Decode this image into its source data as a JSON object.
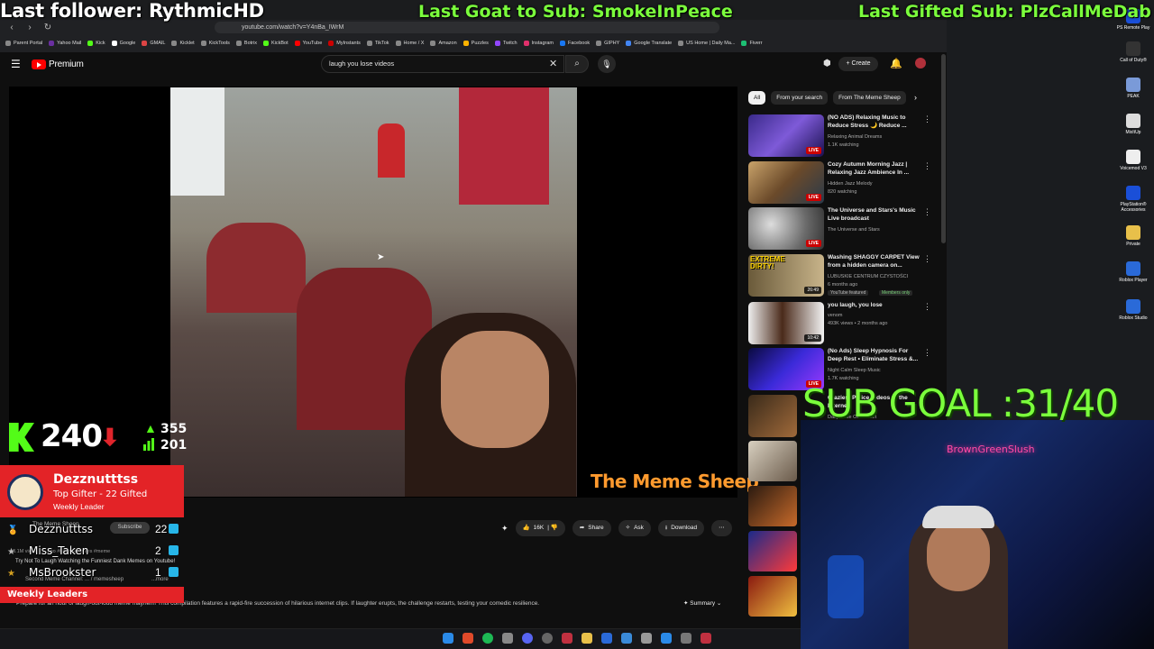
{
  "overlay": {
    "last_follower": "Last follower: RythmicHD",
    "last_goat": "Last Goat to Sub: SmokeInPeace",
    "last_gifted": "Last Gifted Sub: PlzCallMeDab",
    "sub_goal": "SUB GOAL :31/40",
    "kick_viewers": "240",
    "stat_up": "355",
    "stat_bars": "201",
    "top_gifter": {
      "name": "Dezznutttss",
      "line1": "Top Gifter - 22 Gifted",
      "line2": "Weekly Leader"
    },
    "leaderboard": [
      {
        "name": "Dezznutttss",
        "count": "22"
      },
      {
        "name": "Miss_Taken",
        "count": "2"
      },
      {
        "name": "MsBrookster",
        "count": "1"
      }
    ],
    "leaderboard_title": "Weekly Leaders",
    "cam_sign": "BrownGreenSlush",
    "colors": {
      "goal_green": "#7bff3c",
      "kick_green": "#53fc18",
      "alert_red": "#e32327"
    }
  },
  "browser": {
    "url": "youtube.com/watch?v=Y4nBa_IWrM",
    "bookmarks": [
      "Parent Portal",
      "Yahoo Mail",
      "Kick",
      "Google",
      "GMAIL",
      "Kicklet",
      "KickTools",
      "Botrix",
      "KickBot",
      "YouTube",
      "MyInstants",
      "TikTok",
      "Home / X",
      "Amazon",
      "Puzzles",
      "Twitch",
      "Instagram",
      "Facebook",
      "GIPHY",
      "Google Translate",
      "US Home | Daily Ma...",
      "Fiverr"
    ]
  },
  "youtube": {
    "brand": "Premium",
    "search_value": "laugh you lose videos",
    "create_label": "Create",
    "watermark": "The Meme Sheep",
    "channel": "The Meme Sheep",
    "subscribe": "Subscribe",
    "actions": {
      "likes": "16K",
      "share": "Share",
      "ask": "Ask",
      "download": "Download"
    },
    "desc_line1": "3.1M views · ... ago  #funny #memes #meme",
    "desc_line2": "Try Not To Laugh Watching the Funniest Dank Memes on Youtube!",
    "desc_line3": "Second Meme Channel:  ... / memesheep",
    "more": "...more",
    "desc_body": "Prepare for an hour of laugh-out-loud meme mayhem! This compilation features a rapid-fire succession of hilarious internet clips. If laughter erupts, the challenge restarts, testing your comedic resilience.",
    "summary": "Summary",
    "chips": [
      "All",
      "From your search",
      "From The Meme Sheep"
    ],
    "recs": [
      {
        "title": "(NO ADS) Relaxing Music to Reduce Stress 🌙 Reduce ...",
        "channel": "Relaxing Animal Dreams",
        "meta": "1.1K watching",
        "badge": "LIVE"
      },
      {
        "title": "Cozy Autumn Morning Jazz | Relaxing Jazz Ambience In ...",
        "channel": "Hidden Jazz Melody",
        "meta": "820 watching",
        "badge": "LIVE"
      },
      {
        "title": "The Universe and Stars's Music Live broadcast",
        "channel": "The Universe and Stars",
        "meta": "",
        "badge": "LIVE"
      },
      {
        "title": "Washing SHAGGY CARPET View from a hidden camera on...",
        "channel": "LUBUSKIE CENTRUM CZYSTOŚCI",
        "meta": "6 months ago",
        "badge": "26:49",
        "tag": "YouTube featured",
        "tag2": "Members only",
        "thumb_text": "EXTREME DIRTY!"
      },
      {
        "title": "you laugh, you lose",
        "channel": "venom",
        "meta": "493K views • 2 months ago",
        "badge": "10:42"
      },
      {
        "title": "(No Ads) Sleep Hypnosis For Deep Rest • Eliminate Stress &...",
        "channel": "Night Calm Sleep Music",
        "meta": "1.7K watching",
        "badge": "LIVE"
      },
      {
        "title": "Craziest Police Videos of the Internet",
        "channel": "Daily Dose Of Internet",
        "meta": "",
        "badge": ""
      }
    ]
  },
  "desktop": [
    {
      "label": "PS Remote Play"
    },
    {
      "label": "Call of Duty®"
    },
    {
      "label": "PEAK"
    },
    {
      "label": "MixItUp"
    },
    {
      "label": "Voicemod V3"
    },
    {
      "label": "PlayStation® Accessories"
    },
    {
      "label": "Private"
    },
    {
      "label": "Roblox Player"
    },
    {
      "label": "Roblox Studio"
    }
  ]
}
